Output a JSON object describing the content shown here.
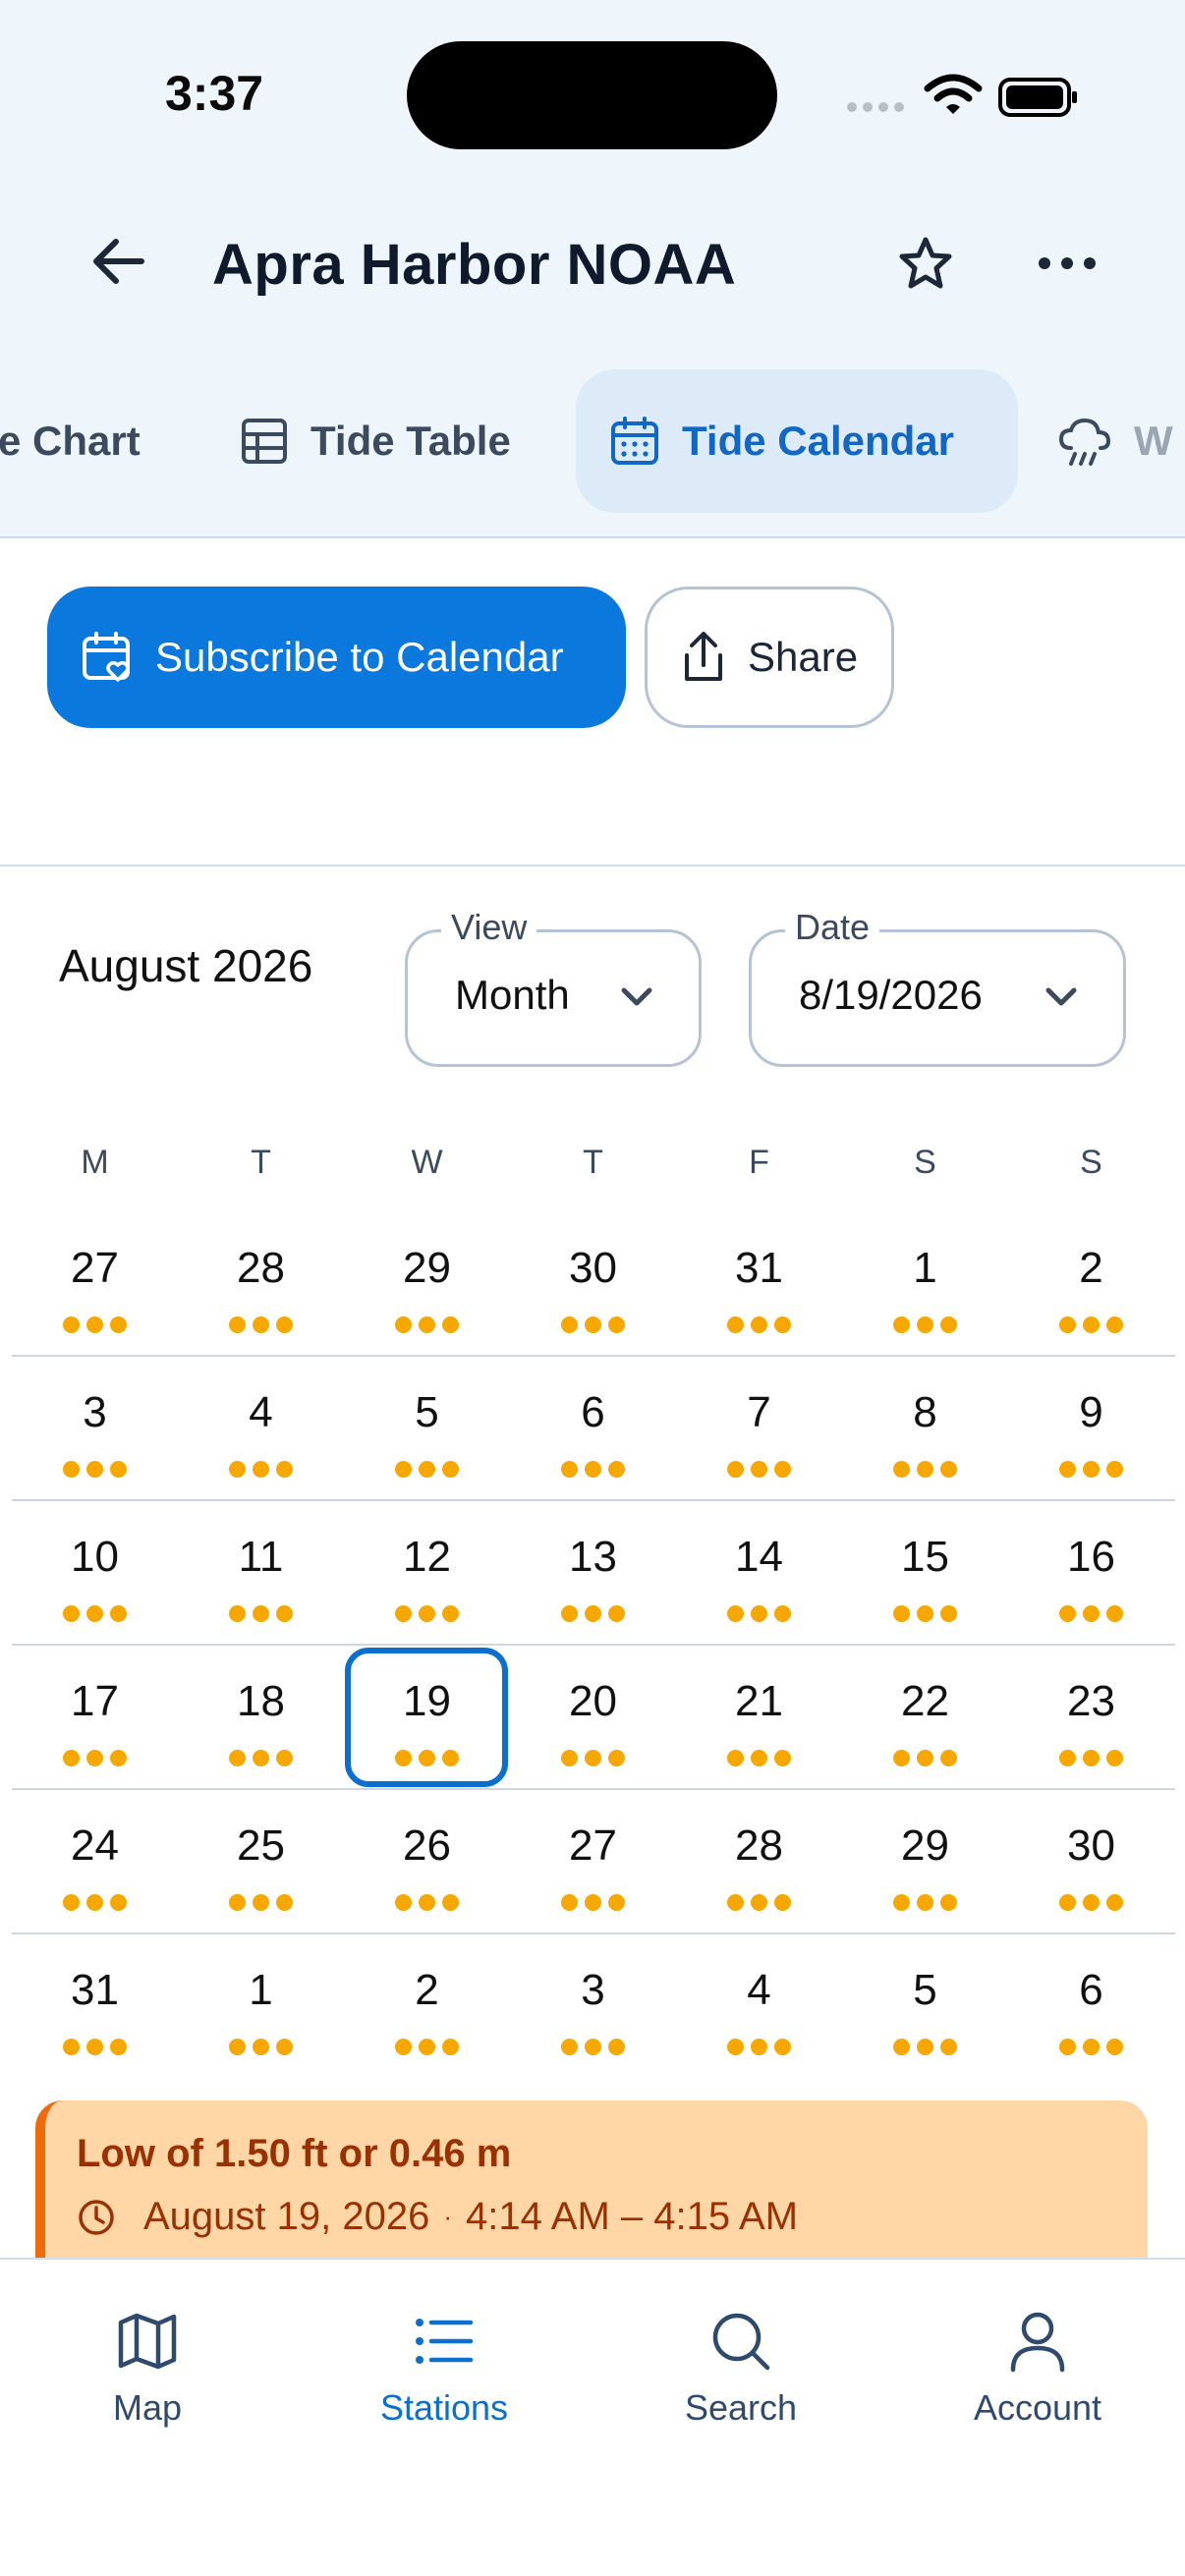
{
  "status_bar": {
    "time": "3:37"
  },
  "header": {
    "title": "Apra Harbor NOAA"
  },
  "tabs": [
    {
      "label": "Tide Chart",
      "visible_text": "e Chart",
      "icon": "chart-icon"
    },
    {
      "label": "Tide Table",
      "icon": "table-icon"
    },
    {
      "label": "Tide Calendar",
      "icon": "calendar-icon",
      "active": true
    },
    {
      "label": "W",
      "icon": "rain-cloud-icon"
    }
  ],
  "actions": {
    "subscribe_label": "Subscribe to Calendar",
    "share_label": "Share"
  },
  "calendar": {
    "month_title": "August 2026",
    "view_label": "View",
    "view_value": "Month",
    "date_label": "Date",
    "date_value": "8/19/2026",
    "weekdays": [
      "M",
      "T",
      "W",
      "T",
      "F",
      "S",
      "S"
    ],
    "weeks": [
      [
        "27",
        "28",
        "29",
        "30",
        "31",
        "1",
        "2"
      ],
      [
        "3",
        "4",
        "5",
        "6",
        "7",
        "8",
        "9"
      ],
      [
        "10",
        "11",
        "12",
        "13",
        "14",
        "15",
        "16"
      ],
      [
        "17",
        "18",
        "19",
        "20",
        "21",
        "22",
        "23"
      ],
      [
        "24",
        "25",
        "26",
        "27",
        "28",
        "29",
        "30"
      ],
      [
        "31",
        "1",
        "2",
        "3",
        "4",
        "5",
        "6"
      ]
    ],
    "selected_day": "19",
    "dot_color": "#f7a800",
    "accent_color": "#0a6fcf"
  },
  "event": {
    "title": "Low of 1.50 ft or 0.46 m",
    "date": "August 19, 2026",
    "separator": "·",
    "time_range": "4:14 AM – 4:15 AM"
  },
  "bottom_nav": [
    {
      "label": "Map",
      "icon": "map-icon"
    },
    {
      "label": "Stations",
      "icon": "list-icon",
      "active": true
    },
    {
      "label": "Search",
      "icon": "search-icon"
    },
    {
      "label": "Account",
      "icon": "account-icon"
    }
  ]
}
